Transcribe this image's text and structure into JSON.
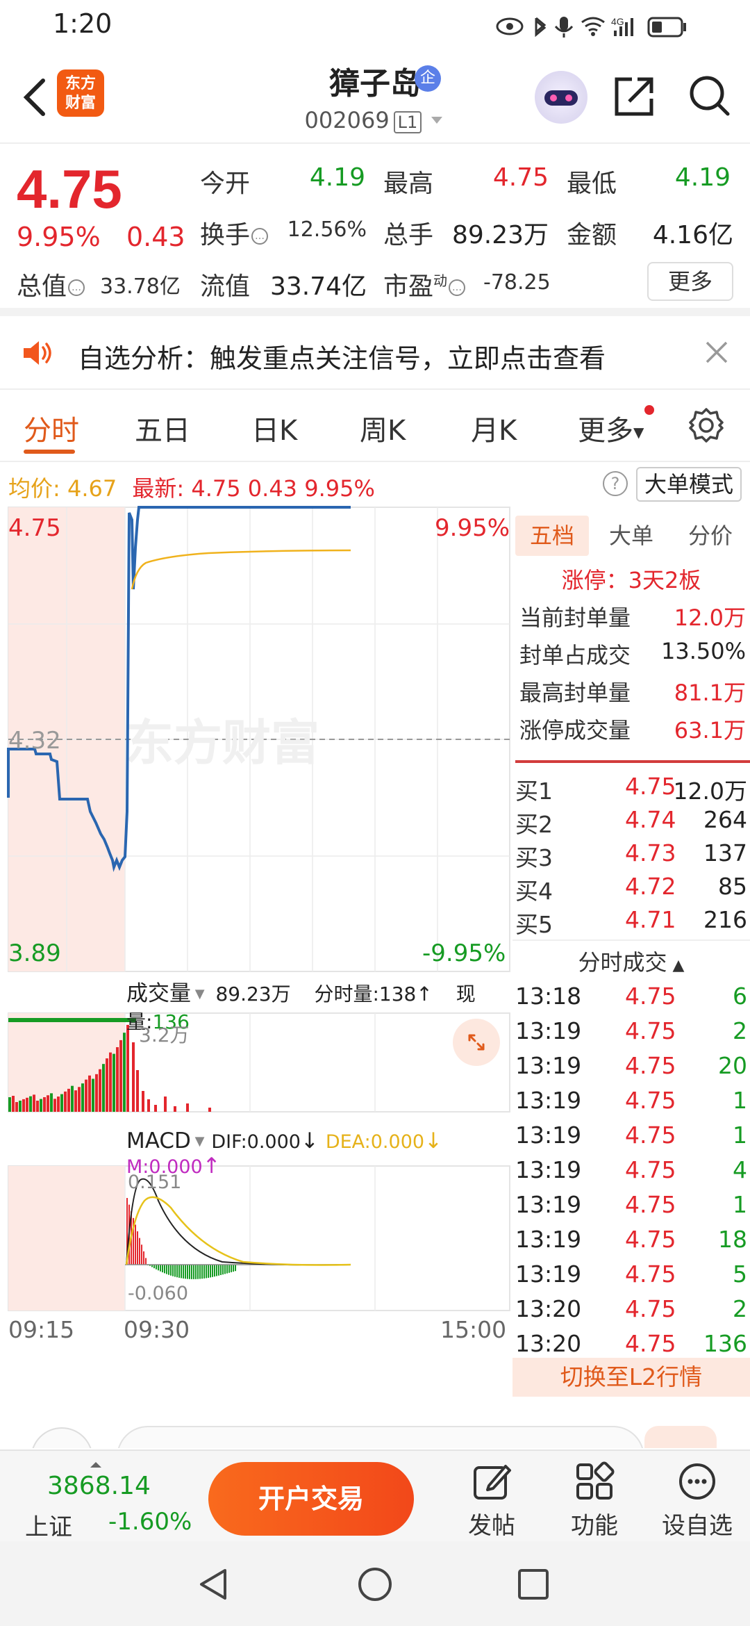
{
  "status_bar": {
    "time": "1:20",
    "network": "4G"
  },
  "header": {
    "logo_line1": "东方",
    "logo_line2": "财富",
    "stock_name": "獐子岛",
    "stock_badge": "企",
    "stock_code": "002069",
    "level_badge": "L1"
  },
  "quote": {
    "price": "4.75",
    "change_pct": "9.95%",
    "change": "0.43",
    "open_label": "今开",
    "open": "4.19",
    "high_label": "最高",
    "high": "4.75",
    "low_label": "最低",
    "low": "4.19",
    "turnover_label": "换手",
    "turnover": "12.56%",
    "volume_label": "总手",
    "volume": "89.23万",
    "amount_label": "金额",
    "amount": "4.16亿",
    "mktcap_label": "总值",
    "mktcap": "33.78亿",
    "float_label": "流值",
    "float_cap": "33.74亿",
    "pe_label": "市盈",
    "pe_sup": "动",
    "pe": "-78.25",
    "more_button": "更多"
  },
  "notice": {
    "text": "自选分析：触发重点关注信号，立即点击查看"
  },
  "tabs": [
    "分时",
    "五日",
    "日K",
    "周K",
    "月K",
    "更多"
  ],
  "info_line": {
    "avg_label": "均价:",
    "avg": "4.67",
    "latest_label": "最新:",
    "latest": "4.75",
    "latest_chg": "0.43",
    "latest_pct": "9.95%",
    "mode_button": "大单模式"
  },
  "chart": {
    "watermark": "东方财富",
    "price_top": "4.75",
    "price_mid": "4.32",
    "price_bottom": "3.89",
    "pct_top": "9.95%",
    "pct_bottom": "-9.95%",
    "volume_label": "成交量",
    "volume_total": "89.23万",
    "volume_info_label": "分时量:",
    "volume_info": "138",
    "now_label": "现量:",
    "now_value": "136",
    "volume_max": "3.2万",
    "macd_label": "MACD",
    "dif": "DIF:0.000",
    "dea": "DEA:0.000",
    "m": "M:0.000",
    "macd_top": "0.151",
    "macd_bottom": "-0.060",
    "time_start": "09:15",
    "time_open": "09:30",
    "time_end": "15:00"
  },
  "right_panel": {
    "tabs": [
      "五档",
      "大单",
      "分价"
    ],
    "limit_up_title": "涨停：3天2板",
    "limit_up_stats": [
      {
        "label": "当前封单量",
        "value": "12.0万"
      },
      {
        "label": "封单占成交",
        "value": "13.50%"
      },
      {
        "label": "最高封单量",
        "value": "81.1万"
      },
      {
        "label": "涨停成交量",
        "value": "63.1万"
      }
    ],
    "order_book": [
      {
        "label": "买1",
        "price": "4.75",
        "qty": "12.0万"
      },
      {
        "label": "买2",
        "price": "4.74",
        "qty": "264"
      },
      {
        "label": "买3",
        "price": "4.73",
        "qty": "137"
      },
      {
        "label": "买4",
        "price": "4.72",
        "qty": "85"
      },
      {
        "label": "买5",
        "price": "4.71",
        "qty": "216"
      }
    ],
    "ticks_title": "分时成交",
    "ticks": [
      {
        "time": "13:18",
        "price": "4.75",
        "vol": "6"
      },
      {
        "time": "13:19",
        "price": "4.75",
        "vol": "2"
      },
      {
        "time": "13:19",
        "price": "4.75",
        "vol": "20"
      },
      {
        "time": "13:19",
        "price": "4.75",
        "vol": "1"
      },
      {
        "time": "13:19",
        "price": "4.75",
        "vol": "1"
      },
      {
        "time": "13:19",
        "price": "4.75",
        "vol": "4"
      },
      {
        "time": "13:19",
        "price": "4.75",
        "vol": "1"
      },
      {
        "time": "13:19",
        "price": "4.75",
        "vol": "18"
      },
      {
        "time": "13:19",
        "price": "4.75",
        "vol": "5"
      },
      {
        "time": "13:20",
        "price": "4.75",
        "vol": "2"
      },
      {
        "time": "13:20",
        "price": "4.75",
        "vol": "136"
      }
    ],
    "l2_button": "切换至L2行情"
  },
  "bottom_bar": {
    "index_value": "3868.14",
    "index_name": "上证",
    "index_pct": "-1.60%",
    "trade_button": "开户交易",
    "items": [
      "发帖",
      "功能",
      "设自选"
    ]
  },
  "colors": {
    "up": "#e3262d",
    "down": "#169b23",
    "accent": "#e05a1b"
  }
}
